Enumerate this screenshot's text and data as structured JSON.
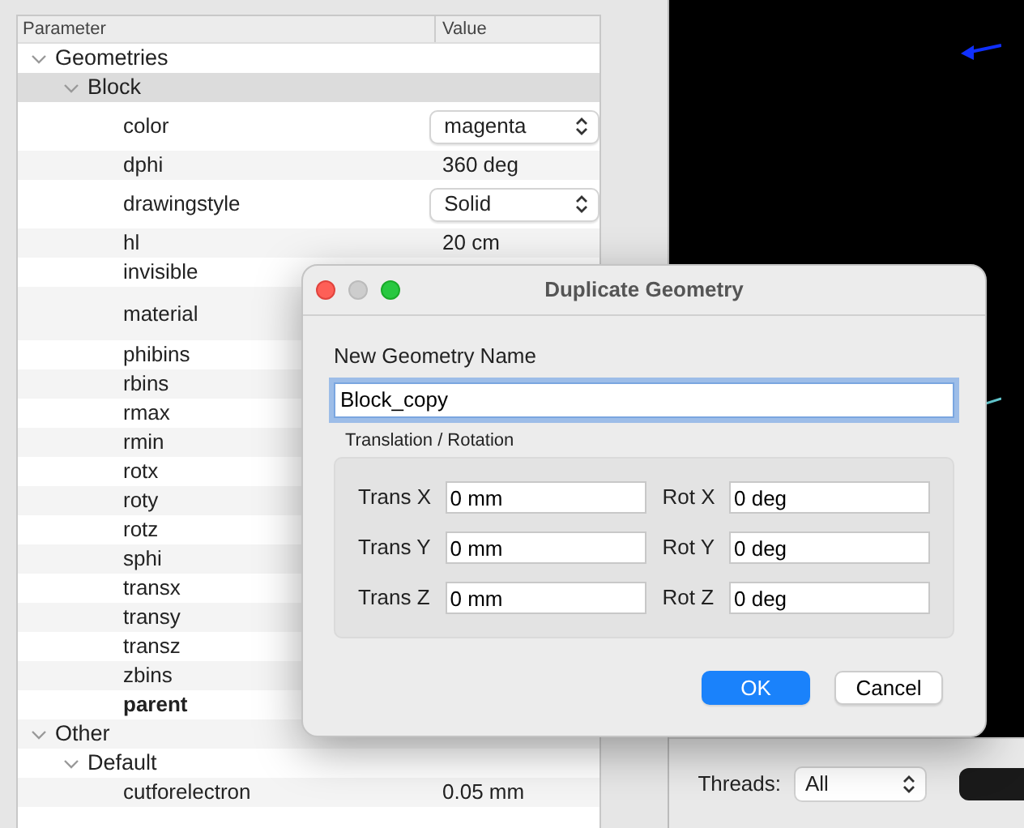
{
  "tree": {
    "columns": [
      "Parameter",
      "Value"
    ],
    "items": [
      {
        "label": "Geometries",
        "expanded": true,
        "selected": false,
        "children": [
          {
            "label": "Block",
            "expanded": true,
            "selected": true,
            "children": [
              {
                "label": "color",
                "kind": "select",
                "value": "magenta",
                "bold": false,
                "selected": false
              },
              {
                "label": "dphi",
                "kind": "text",
                "value": "360 deg",
                "bold": false,
                "selected": false
              },
              {
                "label": "drawingstyle",
                "kind": "select",
                "value": "Solid",
                "bold": false,
                "selected": false
              },
              {
                "label": "hl",
                "kind": "text",
                "value": "20 cm",
                "bold": false,
                "selected": false
              },
              {
                "label": "invisible",
                "kind": "hidden",
                "bold": false,
                "selected": false
              },
              {
                "label": "material",
                "kind": "hidden-tall",
                "bold": false,
                "selected": false
              },
              {
                "label": "phibins",
                "kind": "hidden",
                "bold": false,
                "selected": false
              },
              {
                "label": "rbins",
                "kind": "hidden",
                "bold": false,
                "selected": false
              },
              {
                "label": "rmax",
                "kind": "hidden",
                "bold": false,
                "selected": false
              },
              {
                "label": "rmin",
                "kind": "hidden",
                "bold": false,
                "selected": false
              },
              {
                "label": "rotx",
                "kind": "hidden",
                "bold": false,
                "selected": false
              },
              {
                "label": "roty",
                "kind": "hidden",
                "bold": false,
                "selected": false
              },
              {
                "label": "rotz",
                "kind": "hidden",
                "bold": false,
                "selected": false
              },
              {
                "label": "sphi",
                "kind": "hidden",
                "bold": false,
                "selected": false
              },
              {
                "label": "transx",
                "kind": "hidden",
                "bold": false,
                "selected": false
              },
              {
                "label": "transy",
                "kind": "hidden",
                "bold": false,
                "selected": false
              },
              {
                "label": "transz",
                "kind": "hidden",
                "bold": false,
                "selected": false
              },
              {
                "label": "zbins",
                "kind": "hidden",
                "bold": false,
                "selected": false
              },
              {
                "label": "parent",
                "kind": "hidden",
                "bold": true,
                "selected": false
              }
            ]
          }
        ]
      },
      {
        "label": "Other",
        "expanded": true,
        "selected": false,
        "children": [
          {
            "label": "Default",
            "expanded": true,
            "selected": false,
            "children": [
              {
                "label": "cutforelectron",
                "kind": "text",
                "value": "0.05 mm",
                "bold": false,
                "selected": false
              }
            ]
          }
        ]
      }
    ]
  },
  "viewer": {
    "threads_label": "Threads:",
    "threads_value": "All"
  },
  "dialog": {
    "title": "Duplicate Geometry",
    "name_label": "New Geometry Name",
    "name_value": "Block_copy",
    "name_focused": true,
    "group_title": "Translation / Rotation",
    "fields": [
      {
        "label": "Trans X",
        "value": "0 mm"
      },
      {
        "label": "Rot X",
        "value": "0 deg"
      },
      {
        "label": "Trans Y",
        "value": "0 mm"
      },
      {
        "label": "Rot Y",
        "value": "0 deg"
      },
      {
        "label": "Trans Z",
        "value": "0 mm"
      },
      {
        "label": "Rot Z",
        "value": "0 deg"
      }
    ],
    "buttons": [
      {
        "label": "OK",
        "default": true
      },
      {
        "label": "Cancel",
        "default": false
      }
    ]
  }
}
